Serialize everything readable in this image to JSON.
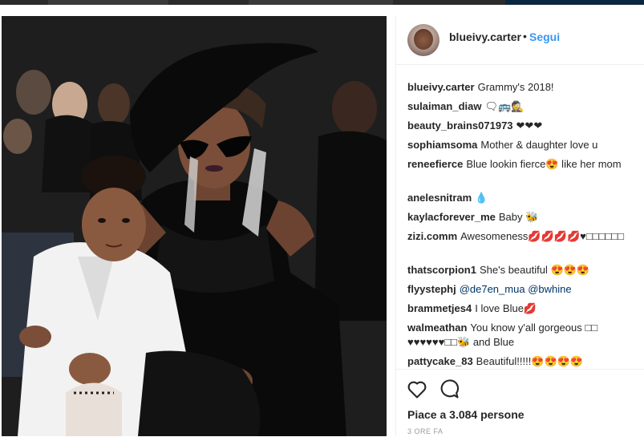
{
  "post": {
    "username": "blueivy.carter",
    "separator": "•",
    "follow_label": "Segui",
    "likes_text": "Piace a 3.084 persone",
    "timestamp": "3 ORE FA"
  },
  "comments": [
    {
      "user": "blueivy.carter",
      "text": "Grammy's 2018!"
    },
    {
      "user": "sulaiman_diaw",
      "text": "🗨🚌🕵"
    },
    {
      "user": "beauty_brains071973",
      "text": "❤❤❤"
    },
    {
      "user": "sophiamsoma",
      "text": "Mother & daughter love u"
    },
    {
      "user": "reneefierce",
      "text": "Blue lookin fierce😍 like her mom"
    },
    {
      "user": "anelesnitram",
      "text": "💧"
    },
    {
      "user": "kaylacforever_me",
      "text": "Baby 🐝"
    },
    {
      "user": "zizi.comm",
      "text": "Awesomeness💋💋💋💋♥□□□□□□"
    },
    {
      "user": "thatscorpion1",
      "text": "She's beautiful 😍😍😍"
    },
    {
      "user": "flyystephj",
      "mention1": "@de7en_mua",
      "mention2": "@bwhine"
    },
    {
      "user": "brammetjes4",
      "text": "I love Blue💋"
    },
    {
      "user": "walmeathan",
      "text": "You know y'all gorgeous □□ ♥♥♥♥♥♥□□🐝 and Blue"
    },
    {
      "user": "pattycake_83",
      "text": "Beautiful!!!!!😍😍😍😍"
    }
  ],
  "icons": {
    "like": "heart-icon",
    "comment": "comment-bubble-icon"
  }
}
